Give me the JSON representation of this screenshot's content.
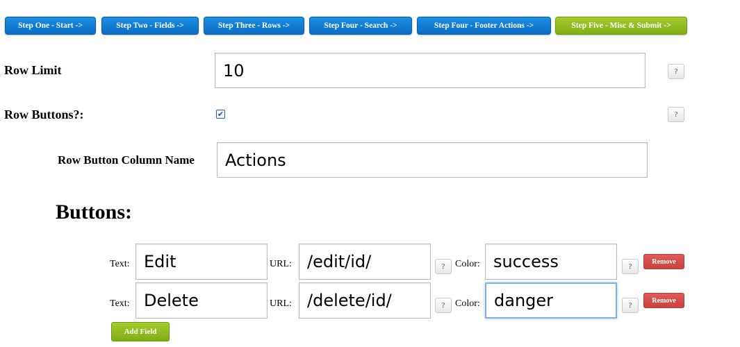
{
  "steps": [
    "Step One - Start ->",
    "Step Two - Fields ->",
    "Step Three - Rows ->",
    "Step Four - Search ->",
    "Step Four - Footer Actions ->",
    "Step Five - Misc & Submit ->"
  ],
  "row_limit": {
    "label": "Row Limit",
    "value": "10"
  },
  "row_buttons": {
    "label": "Row Buttons?:",
    "checked": true
  },
  "column_name": {
    "label": "Row Button Column Name",
    "value": "Actions"
  },
  "buttons_heading": "Buttons:",
  "field_labels": {
    "text": "Text:",
    "url": "URL:",
    "color": "Color:"
  },
  "button_rows": [
    {
      "text": "Edit",
      "url": "/edit/id/",
      "color": "success"
    },
    {
      "text": "Delete",
      "url": "/delete/id/",
      "color": "danger"
    }
  ],
  "help_label": "?",
  "remove_label": "Remove",
  "add_field_label": "Add Field",
  "colors": {
    "step_blue": "#0b6cc6",
    "step_active_green": "#7fad14",
    "remove_red": "#c8413d"
  }
}
